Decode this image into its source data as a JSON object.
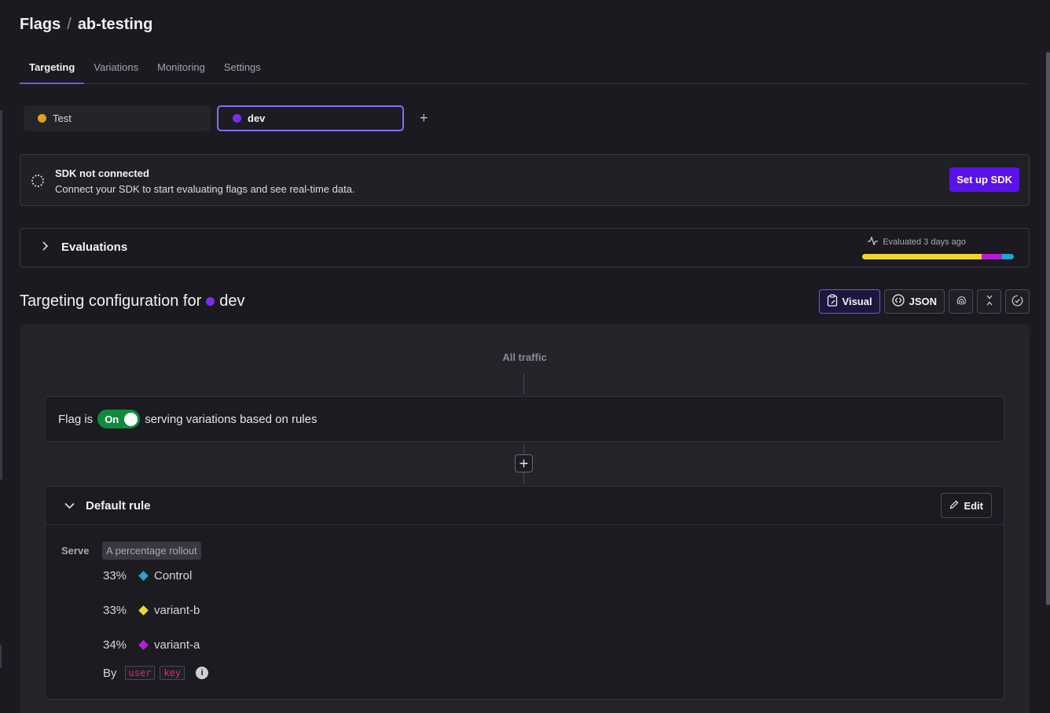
{
  "breadcrumb": {
    "root": "Flags",
    "separator": "/",
    "current": "ab-testing"
  },
  "tabs": [
    {
      "label": "Targeting",
      "active": true
    },
    {
      "label": "Variations",
      "active": false
    },
    {
      "label": "Monitoring",
      "active": false
    },
    {
      "label": "Settings",
      "active": false
    }
  ],
  "environments": [
    {
      "name": "Test",
      "color": "#e0a21a",
      "selected": false
    },
    {
      "name": "dev",
      "color": "#7a2ff0",
      "selected": true
    }
  ],
  "sdk_banner": {
    "title": "SDK not connected",
    "message": "Connect your SDK to start evaluating flags and see real-time data.",
    "button": "Set up SDK"
  },
  "evaluations": {
    "label": "Evaluations",
    "last_evaluated": "Evaluated 3 days ago",
    "distribution": [
      {
        "color": "#f2d431",
        "share": 0.79
      },
      {
        "color": "#b31fd6",
        "share": 0.13
      },
      {
        "color": "#21a7cf",
        "share": 0.08
      }
    ]
  },
  "targeting": {
    "title_prefix": "Targeting configuration for",
    "env_name": "dev",
    "env_color": "#7a2ff0",
    "view_visual": "Visual",
    "view_json": "JSON"
  },
  "flow": {
    "all_traffic": "All traffic",
    "flag_prefix": "Flag is",
    "toggle_label": "On",
    "flag_suffix": "serving variations based on rules"
  },
  "default_rule": {
    "title": "Default rule",
    "edit": "Edit",
    "serve_label": "Serve",
    "serve_value": "A percentage rollout",
    "variations": [
      {
        "pct": "33%",
        "name": "Control",
        "color": "#21a7cf"
      },
      {
        "pct": "33%",
        "name": "variant-b",
        "color": "#f2d431"
      },
      {
        "pct": "34%",
        "name": "variant-a",
        "color": "#b31fd6"
      }
    ],
    "by_label": "By",
    "by_attrs": [
      "user",
      "key"
    ]
  }
}
